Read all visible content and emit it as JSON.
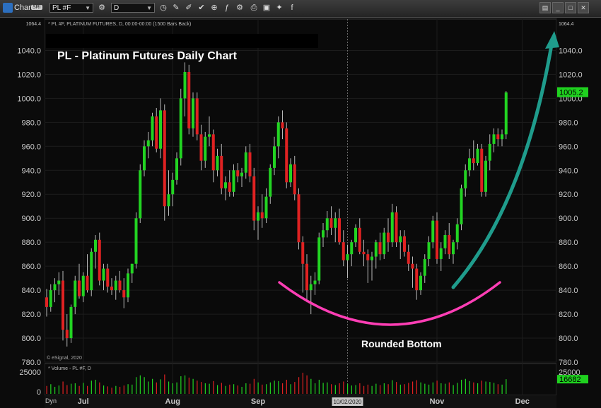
{
  "toolbar": {
    "app_label": "Chart",
    "badge": "SRI",
    "symbol_value": "PL #F",
    "interval_value": "D"
  },
  "chart_header": "* PL #F, PLATINUM FUTURES, D, 00:00-00:00 (1500 Bars Back)",
  "volume_header": "* Volume - PL #F, D",
  "copyright": "© eSignal, 2020",
  "dyn_label": "Dyn",
  "annotations": {
    "title": "PL - Platinum Futures Daily Chart",
    "rounded_bottom": "Rounded Bottom"
  },
  "colors": {
    "up": "#22d422",
    "down": "#e02222",
    "arc": "#ff3eb5",
    "arrow": "#1f9c8c",
    "price_tag": "#1fd11f"
  },
  "chart_data": {
    "type": "candlestick",
    "title": "PL - Platinum Futures Daily Chart",
    "symbol": "PL #F",
    "interval": "D",
    "ylim": [
      780,
      1064.4
    ],
    "y_ticks": [
      780,
      800,
      820,
      840,
      860,
      880,
      900,
      920,
      940,
      960,
      980,
      1000,
      1020,
      1040
    ],
    "y_tick_labels": [
      "780.0",
      "800.0",
      "820.0",
      "840.0",
      "860.0",
      "880.0",
      "900.0",
      "920.0",
      "940.0",
      "960.0",
      "980.0",
      "1000.0",
      "1020.0",
      "1040.0"
    ],
    "y_max_label": "1064.4",
    "last_price": 1005.2,
    "last_price_label": "1005.2",
    "x_month_labels": [
      {
        "label": "Jul",
        "bar": 9
      },
      {
        "label": "Aug",
        "bar": 31
      },
      {
        "label": "Sep",
        "bar": 52
      },
      {
        "label": "Nov",
        "bar": 96
      },
      {
        "label": "Dec",
        "bar": 117
      }
    ],
    "crosshair": {
      "bar": 74,
      "label": "10/02/2020"
    },
    "volume": {
      "ylim": [
        0,
        32000
      ],
      "tick": 25000,
      "tick_label": "25000",
      "zero_label": "0",
      "last": 16682,
      "last_label": "16682"
    },
    "candles": [
      [
        834,
        841,
        818,
        826,
        9000
      ],
      [
        826,
        845,
        822,
        840,
        11000
      ],
      [
        840,
        850,
        830,
        845,
        8000
      ],
      [
        845,
        855,
        836,
        848,
        9500
      ],
      [
        848,
        856,
        798,
        807,
        14000
      ],
      [
        807,
        820,
        793,
        800,
        10000
      ],
      [
        800,
        828,
        796,
        826,
        11500
      ],
      [
        826,
        852,
        820,
        848,
        12000
      ],
      [
        848,
        862,
        833,
        835,
        9000
      ],
      [
        835,
        855,
        830,
        852,
        12500
      ],
      [
        852,
        870,
        838,
        840,
        9000
      ],
      [
        840,
        875,
        835,
        872,
        15000
      ],
      [
        872,
        886,
        858,
        882,
        16000
      ],
      [
        882,
        888,
        844,
        848,
        13000
      ],
      [
        848,
        862,
        840,
        858,
        9500
      ],
      [
        858,
        862,
        838,
        843,
        8500
      ],
      [
        843,
        850,
        836,
        840,
        7000
      ],
      [
        840,
        852,
        832,
        848,
        9000
      ],
      [
        848,
        856,
        838,
        840,
        8000
      ],
      [
        840,
        850,
        825,
        834,
        9500
      ],
      [
        834,
        858,
        830,
        854,
        11000
      ],
      [
        854,
        862,
        846,
        862,
        10500
      ],
      [
        862,
        905,
        858,
        900,
        19000
      ],
      [
        900,
        945,
        896,
        940,
        21000
      ],
      [
        940,
        965,
        935,
        960,
        19000
      ],
      [
        960,
        972,
        950,
        965,
        14000
      ],
      [
        965,
        988,
        960,
        985,
        17000
      ],
      [
        985,
        992,
        955,
        958,
        13000
      ],
      [
        958,
        1000,
        950,
        990,
        16500
      ],
      [
        990,
        995,
        898,
        910,
        22000
      ],
      [
        910,
        940,
        902,
        920,
        14000
      ],
      [
        920,
        938,
        910,
        932,
        12000
      ],
      [
        932,
        955,
        928,
        950,
        13000
      ],
      [
        950,
        1008,
        944,
        1000,
        20000
      ],
      [
        1000,
        1030,
        985,
        1022,
        21000
      ],
      [
        1022,
        1028,
        970,
        975,
        18500
      ],
      [
        975,
        1005,
        968,
        1000,
        17000
      ],
      [
        1000,
        1005,
        965,
        970,
        15000
      ],
      [
        970,
        978,
        940,
        948,
        13500
      ],
      [
        948,
        972,
        942,
        968,
        12000
      ],
      [
        968,
        985,
        960,
        970,
        11500
      ],
      [
        970,
        974,
        930,
        940,
        14500
      ],
      [
        940,
        958,
        935,
        952,
        10000
      ],
      [
        952,
        962,
        920,
        925,
        12500
      ],
      [
        925,
        935,
        915,
        930,
        9000
      ],
      [
        930,
        940,
        918,
        922,
        10500
      ],
      [
        922,
        945,
        918,
        940,
        11000
      ],
      [
        940,
        946,
        930,
        935,
        9500
      ],
      [
        935,
        942,
        926,
        938,
        8000
      ],
      [
        938,
        960,
        933,
        955,
        12000
      ],
      [
        955,
        962,
        930,
        935,
        11500
      ],
      [
        935,
        942,
        890,
        898,
        17000
      ],
      [
        898,
        910,
        882,
        905,
        13000
      ],
      [
        905,
        920,
        892,
        900,
        10500
      ],
      [
        900,
        925,
        896,
        918,
        11000
      ],
      [
        918,
        945,
        912,
        942,
        13000
      ],
      [
        942,
        968,
        936,
        960,
        15000
      ],
      [
        960,
        985,
        950,
        980,
        14500
      ],
      [
        980,
        990,
        966,
        975,
        12000
      ],
      [
        975,
        980,
        925,
        930,
        16000
      ],
      [
        930,
        950,
        926,
        945,
        11000
      ],
      [
        945,
        952,
        915,
        920,
        13500
      ],
      [
        920,
        925,
        874,
        880,
        19000
      ],
      [
        880,
        885,
        838,
        862,
        24000
      ],
      [
        862,
        870,
        830,
        840,
        21000
      ],
      [
        840,
        852,
        820,
        845,
        17000
      ],
      [
        845,
        855,
        836,
        848,
        12000
      ],
      [
        848,
        888,
        845,
        884,
        16000
      ],
      [
        884,
        896,
        876,
        890,
        12500
      ],
      [
        890,
        906,
        884,
        900,
        13000
      ],
      [
        900,
        910,
        886,
        892,
        11000
      ],
      [
        892,
        905,
        880,
        900,
        10000
      ],
      [
        900,
        908,
        878,
        880,
        12000
      ],
      [
        880,
        890,
        860,
        865,
        14000
      ],
      [
        865,
        878,
        850,
        870,
        11500
      ],
      [
        870,
        882,
        860,
        880,
        9500
      ],
      [
        880,
        895,
        876,
        892,
        10000
      ],
      [
        892,
        900,
        870,
        872,
        12000
      ],
      [
        872,
        882,
        860,
        870,
        9000
      ],
      [
        870,
        874,
        846,
        865,
        10500
      ],
      [
        865,
        872,
        848,
        868,
        9000
      ],
      [
        868,
        882,
        858,
        880,
        11500
      ],
      [
        880,
        888,
        865,
        870,
        10000
      ],
      [
        870,
        892,
        866,
        888,
        12000
      ],
      [
        888,
        900,
        872,
        880,
        11000
      ],
      [
        880,
        912,
        876,
        905,
        15500
      ],
      [
        905,
        910,
        876,
        880,
        13500
      ],
      [
        880,
        890,
        866,
        885,
        10500
      ],
      [
        885,
        890,
        868,
        872,
        11000
      ],
      [
        872,
        878,
        856,
        862,
        12500
      ],
      [
        862,
        868,
        842,
        858,
        14000
      ],
      [
        858,
        862,
        832,
        840,
        15500
      ],
      [
        840,
        855,
        836,
        852,
        13000
      ],
      [
        852,
        870,
        846,
        866,
        11500
      ],
      [
        866,
        885,
        860,
        880,
        10500
      ],
      [
        880,
        902,
        875,
        898,
        13000
      ],
      [
        898,
        905,
        862,
        866,
        15000
      ],
      [
        866,
        880,
        856,
        875,
        12000
      ],
      [
        875,
        890,
        870,
        886,
        11500
      ],
      [
        886,
        896,
        866,
        870,
        13000
      ],
      [
        870,
        882,
        862,
        880,
        10000
      ],
      [
        880,
        900,
        874,
        895,
        12500
      ],
      [
        895,
        928,
        890,
        925,
        16000
      ],
      [
        925,
        945,
        918,
        940,
        17000
      ],
      [
        940,
        958,
        935,
        950,
        14500
      ],
      [
        950,
        965,
        940,
        946,
        13000
      ],
      [
        946,
        962,
        944,
        958,
        12000
      ],
      [
        958,
        962,
        918,
        922,
        15000
      ],
      [
        922,
        952,
        918,
        948,
        14000
      ],
      [
        948,
        970,
        940,
        962,
        13500
      ],
      [
        962,
        975,
        955,
        970,
        12500
      ],
      [
        970,
        975,
        960,
        966,
        11000
      ],
      [
        966,
        974,
        960,
        970,
        10500
      ],
      [
        970,
        1006,
        966,
        1005,
        16682
      ]
    ]
  }
}
